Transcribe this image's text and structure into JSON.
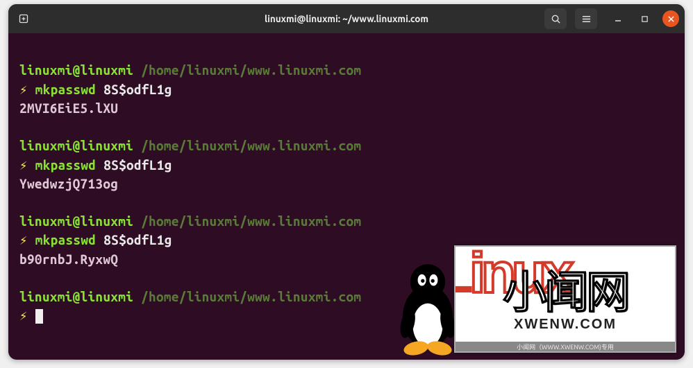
{
  "titlebar": {
    "title": "linuxmi@linuxmi: ~/www.linuxmi.com"
  },
  "prompt": {
    "user_host": "linuxmi@linuxmi",
    "path": "/home/linuxmi/www.linuxmi.com",
    "bolt": "⚡",
    "cmd": "mkpasswd",
    "arg": "8S$odfL1g"
  },
  "blocks": [
    {
      "output": "2MVI6EiE5.lXU"
    },
    {
      "output": "YwedwzjQ713og"
    },
    {
      "output": "b90rnbJ.RyxwQ"
    }
  ],
  "watermark": {
    "bg_text": "Linux",
    "cn_text": "小闻网",
    "sub_text": "XWENW.COM",
    "footer_text": "小闻网（WWW.XWENW.COM)专用"
  }
}
